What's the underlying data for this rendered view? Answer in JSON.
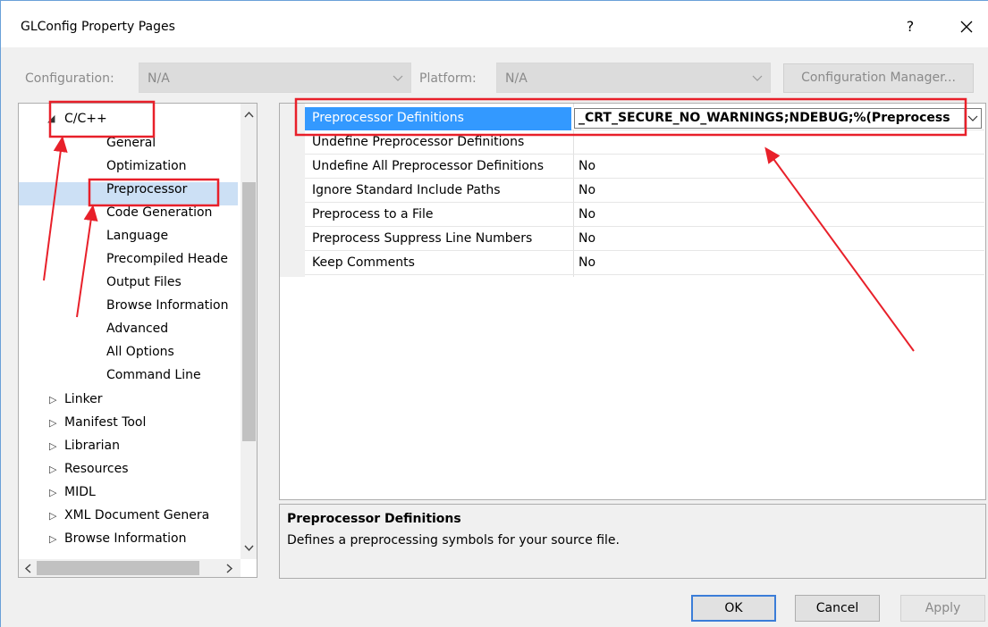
{
  "window": {
    "title": "GLConfig Property Pages",
    "help_label": "?"
  },
  "config_bar": {
    "configuration_label": "Configuration:",
    "configuration_value": "N/A",
    "platform_label": "Platform:",
    "platform_value": "N/A",
    "manager_button": "Configuration Manager..."
  },
  "tree": {
    "parent": "C/C++",
    "children": [
      "General",
      "Optimization",
      "Preprocessor",
      "Code Generation",
      "Language",
      "Precompiled Heade",
      "Output Files",
      "Browse Information",
      "Advanced",
      "All Options",
      "Command Line"
    ],
    "siblings": [
      "Linker",
      "Manifest Tool",
      "Librarian",
      "Resources",
      "MIDL",
      "XML Document Genera",
      "Browse Information"
    ],
    "selected": "Preprocessor"
  },
  "grid": {
    "rows": [
      {
        "name": "Preprocessor Definitions",
        "value": "_CRT_SECURE_NO_WARNINGS;NDEBUG;%(Preprocess"
      },
      {
        "name": "Undefine Preprocessor Definitions",
        "value": ""
      },
      {
        "name": "Undefine All Preprocessor Definitions",
        "value": "No"
      },
      {
        "name": "Ignore Standard Include Paths",
        "value": "No"
      },
      {
        "name": "Preprocess to a File",
        "value": "No"
      },
      {
        "name": "Preprocess Suppress Line Numbers",
        "value": "No"
      },
      {
        "name": "Keep Comments",
        "value": "No"
      }
    ]
  },
  "description": {
    "title": "Preprocessor Definitions",
    "text": "Defines a preprocessing symbols for your source file."
  },
  "buttons": {
    "ok": "OK",
    "cancel": "Cancel",
    "apply": "Apply"
  },
  "colors": {
    "selection": "#3399ff",
    "annotation": "#e8202a",
    "tree_selection": "#cce0f5"
  },
  "icons": [
    "help-icon",
    "close-icon",
    "chevron-down-icon",
    "expand-arrow-icon",
    "collapse-arrow-icon",
    "scroll-up-icon",
    "scroll-down-icon",
    "scroll-left-icon",
    "scroll-right-icon"
  ]
}
